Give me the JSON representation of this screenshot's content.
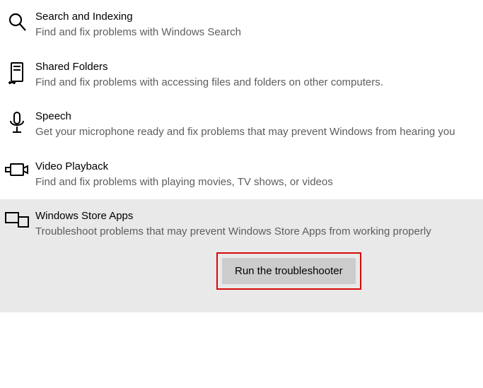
{
  "troubleshooters": [
    {
      "id": "search",
      "title": "Search and Indexing",
      "description": "Find and fix problems with Windows Search"
    },
    {
      "id": "shared-folders",
      "title": "Shared Folders",
      "description": "Find and fix problems with accessing files and folders on other computers."
    },
    {
      "id": "speech",
      "title": "Speech",
      "description": "Get your microphone ready and fix problems that may prevent Windows from hearing you"
    },
    {
      "id": "video",
      "title": "Video Playback",
      "description": "Find and fix problems with playing movies, TV shows, or videos"
    },
    {
      "id": "store",
      "title": "Windows Store Apps",
      "description": "Troubleshoot problems that may prevent Windows Store Apps from working properly"
    }
  ],
  "action": {
    "run_label": "Run the troubleshooter"
  }
}
